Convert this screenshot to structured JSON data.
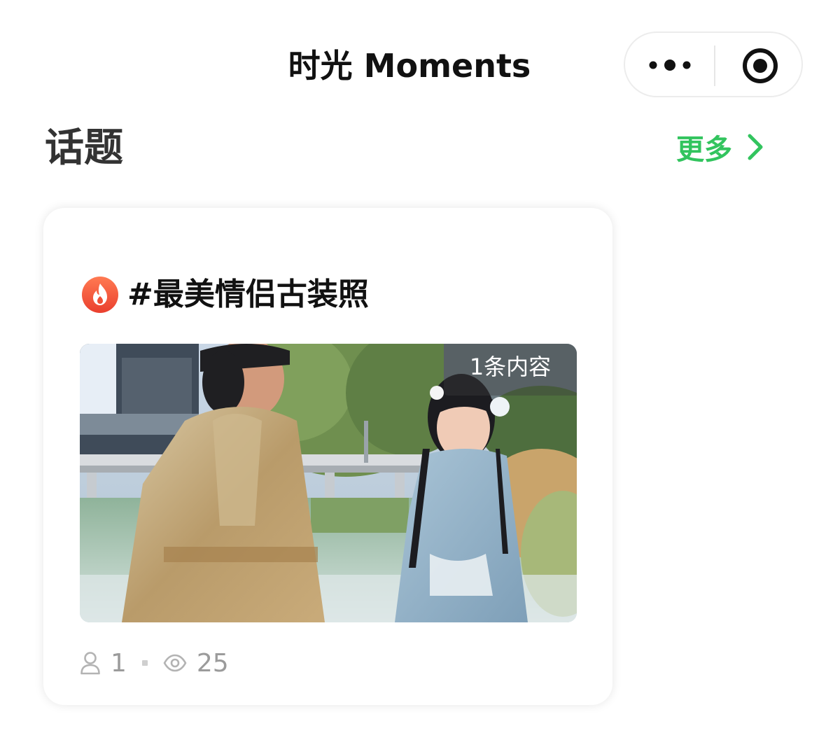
{
  "header": {
    "title": "时光 Moments",
    "more_icon": "more-dots-icon",
    "close_icon": "target-circle-icon"
  },
  "section": {
    "title": "话题",
    "more_label": "更多",
    "more_icon": "chevron-right-icon"
  },
  "topic_card": {
    "icon": "fire-icon",
    "title": "#最美情侣古装照",
    "badge": "1条内容",
    "image_alt": "couple-in-hanfu-photo",
    "participants": "1",
    "views": "25",
    "participants_icon": "user-icon",
    "views_icon": "eye-icon"
  },
  "colors": {
    "accent_green": "#32c45e",
    "fire_red": "#f0523a",
    "text_dark": "#111111",
    "text_muted": "#9b9b9b"
  }
}
